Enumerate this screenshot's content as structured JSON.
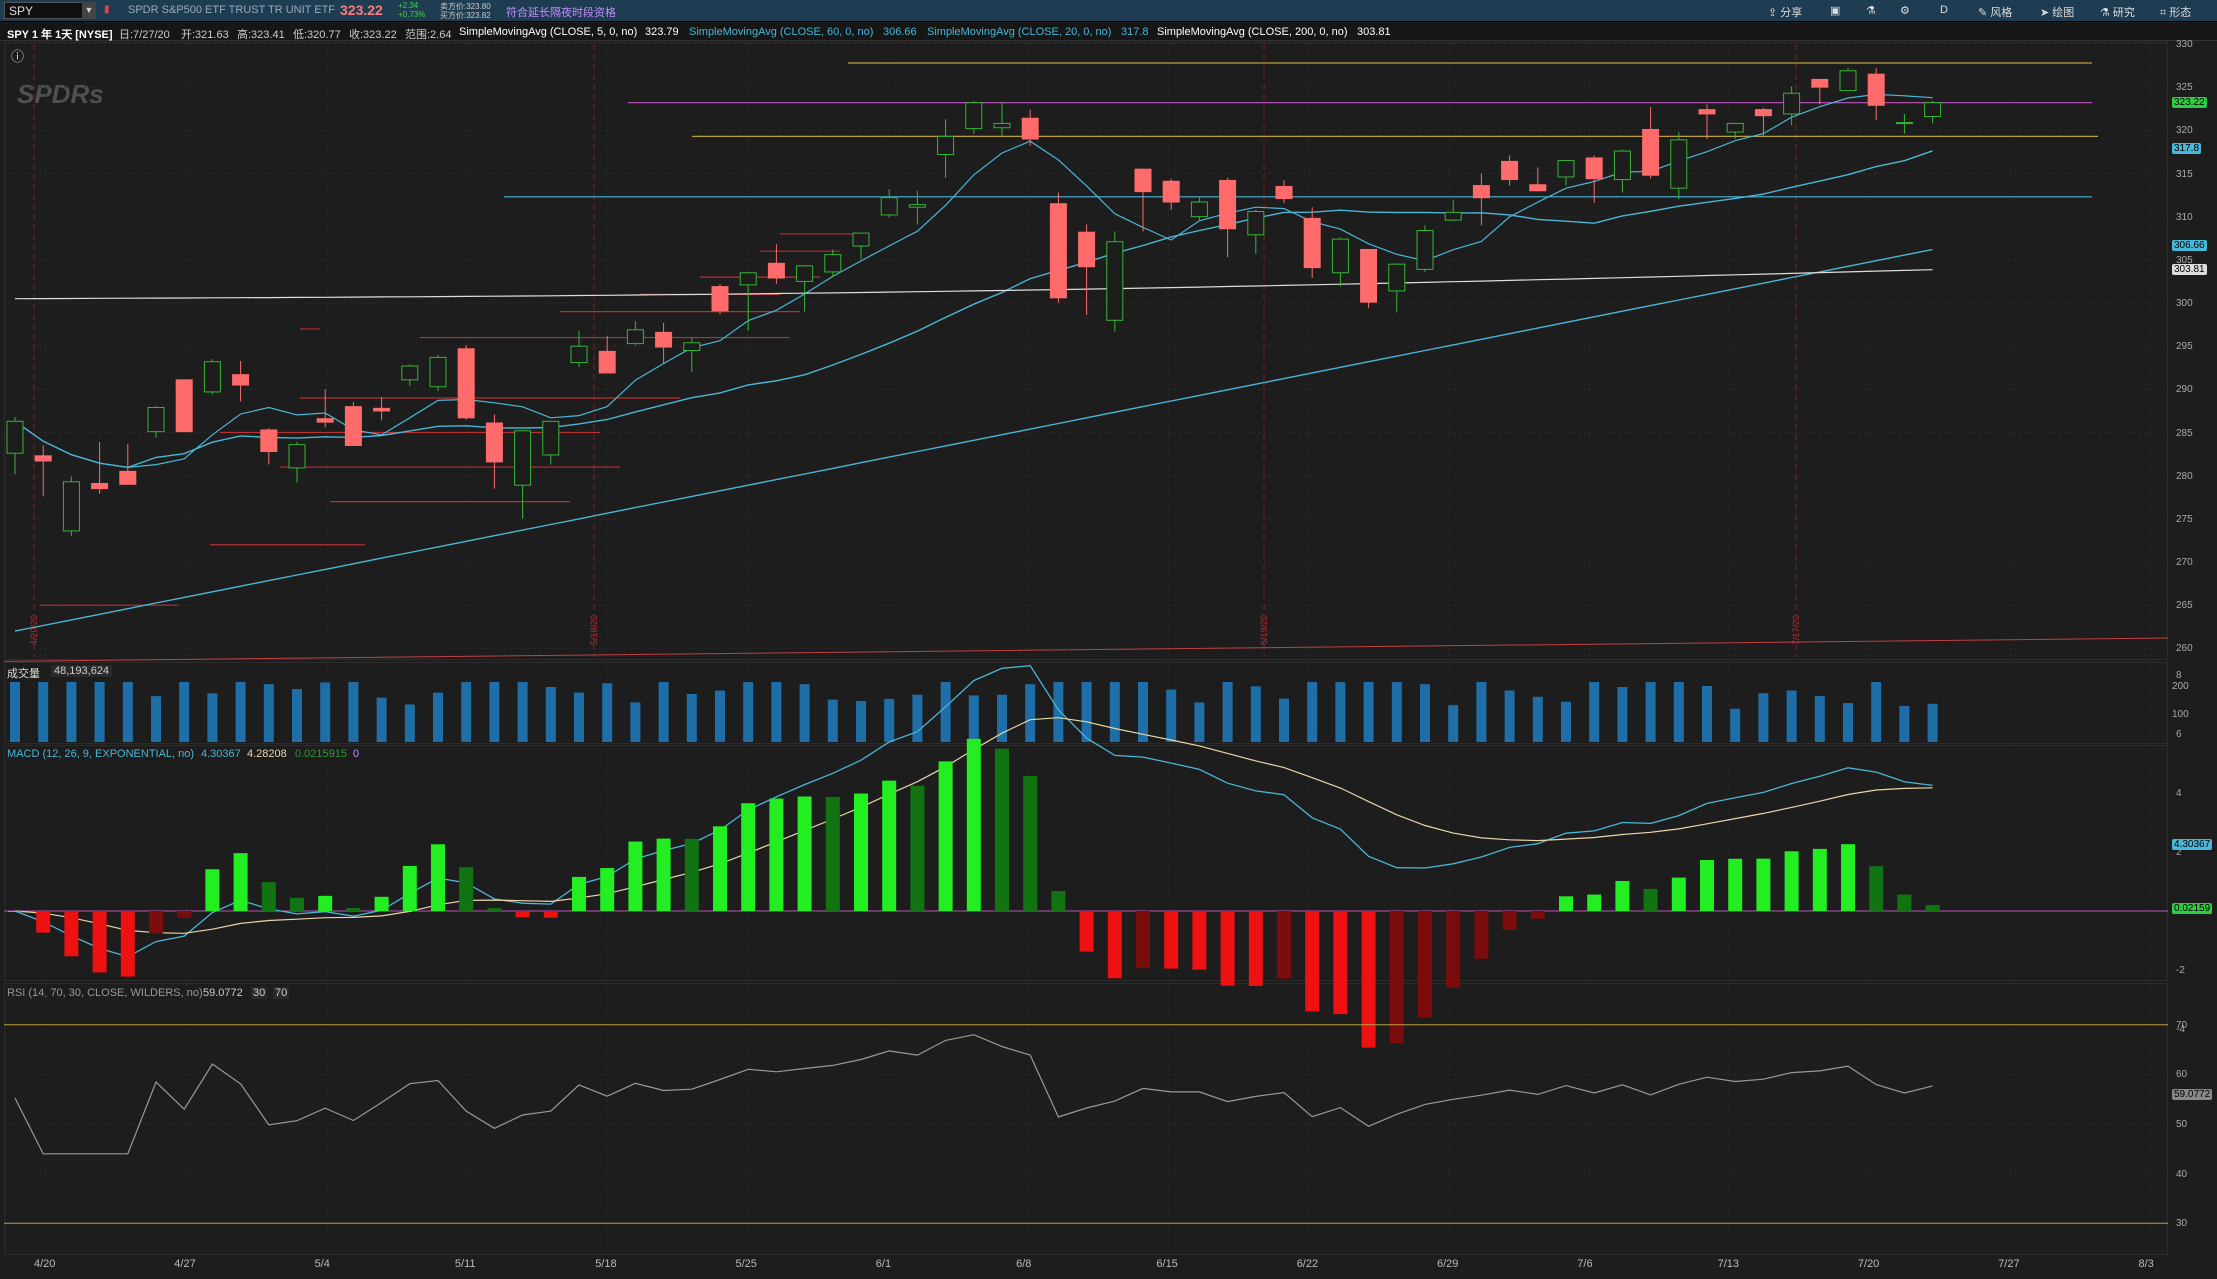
{
  "toolbar": {
    "symbol": "SPY",
    "description": "SPDR S&P500 ETF TRUST TR UNIT ETF",
    "last": "323.22",
    "change": "+2.34",
    "change_pct": "+0.73%",
    "bid": "卖方价:323.80",
    "ask": "买方价:323.82",
    "ext_hours": "符合延长隔夜时段资格",
    "share": "分享",
    "style": "风格",
    "draw": "绘图",
    "study": "研究",
    "pattern": "形态",
    "period": "D"
  },
  "info": {
    "title": "SPY 1 年 1天 [NYSE]",
    "date": "日:7/27/20",
    "open": "开:321.63",
    "high": "高:323.41",
    "low": "低:320.77",
    "close": "收:323.22",
    "range": "范围:2.64",
    "sma5_name": "SimpleMovingAvg (CLOSE, 5, 0, no)",
    "sma5_val": "323.79",
    "sma60_name": "SimpleMovingAvg (CLOSE, 60, 0, no)",
    "sma60_val": "306.66",
    "sma20_name": "SimpleMovingAvg (CLOSE, 20, 0, no)",
    "sma20_val": "317.8",
    "sma200_name": "SimpleMovingAvg (CLOSE, 200, 0, no)",
    "sma200_val": "303.81"
  },
  "watermark": "SPDRs",
  "price_axis": [
    "330",
    "325",
    "320",
    "315",
    "310",
    "305",
    "300",
    "295",
    "290",
    "285",
    "280",
    "275",
    "270",
    "265",
    "260"
  ],
  "price_tags": [
    {
      "text": "323.22",
      "color": "#2ecc40"
    },
    {
      "text": "317.8",
      "color": "#4ab6d8"
    },
    {
      "text": "306.66",
      "color": "#4ab6d8"
    },
    {
      "text": "303.81",
      "color": "#dddddd"
    }
  ],
  "volume": {
    "label": "成交量",
    "value": "48,193,624",
    "axis": [
      "200",
      "100"
    ]
  },
  "macd": {
    "label": "MACD (12, 26, 9, EXPONENTIAL, no)",
    "value": "4.30367",
    "avg": "4.28208",
    "diff": "0.0215915",
    "zero": "0",
    "axis": [
      "8",
      "6",
      "4",
      "2",
      "-2",
      "-4"
    ],
    "tag_value": "4.30367",
    "tag_diff": "0.02159"
  },
  "rsi": {
    "label": "RSI (14, 70, 30, CLOSE, WILDERS, no)",
    "value": "59.0772",
    "ob": "30",
    "os": "70",
    "axis": [
      "70",
      "60",
      "50",
      "40",
      "30"
    ],
    "tag": "59.0772"
  },
  "date_axis": [
    "4/20",
    "4/27",
    "5/4",
    "5/11",
    "5/18",
    "5/25",
    "6/1",
    "6/8",
    "6/15",
    "6/22",
    "6/29",
    "7/6",
    "7/13",
    "7/20",
    "7/27",
    "8/3"
  ],
  "vline_dates": [
    "4/20/20",
    "5/18/20",
    "6/19/20",
    "7/17/20"
  ],
  "chart_data": {
    "type": "candlestick",
    "x": [
      "4/20",
      "4/21",
      "4/22",
      "4/23",
      "4/24",
      "4/27",
      "4/28",
      "4/29",
      "4/30",
      "5/1",
      "5/4",
      "5/5",
      "5/6",
      "5/7",
      "5/8",
      "5/11",
      "5/12",
      "5/13",
      "5/14",
      "5/15",
      "5/18",
      "5/19",
      "5/20",
      "5/21",
      "5/22",
      "5/26",
      "5/27",
      "5/28",
      "5/29",
      "6/1",
      "6/2",
      "6/3",
      "6/4",
      "6/5",
      "6/8",
      "6/9",
      "6/10",
      "6/11",
      "6/12",
      "6/15",
      "6/16",
      "6/17",
      "6/18",
      "6/19",
      "6/22",
      "6/23",
      "6/24",
      "6/25",
      "6/26",
      "6/29",
      "6/30",
      "7/1",
      "7/2",
      "7/6",
      "7/7",
      "7/8",
      "7/9",
      "7/10",
      "7/13",
      "7/14",
      "7/15",
      "7/16",
      "7/17",
      "7/20",
      "7/21",
      "7/22",
      "7/23",
      "7/24",
      "7/27"
    ],
    "ohlc": [
      [
        282.6,
        286.8,
        280.2,
        286.3
      ],
      [
        282.3,
        283.5,
        277.6,
        281.7
      ],
      [
        273.6,
        279.9,
        273.0,
        279.3
      ],
      [
        279.1,
        283.9,
        277.9,
        278.5
      ],
      [
        280.5,
        283.7,
        279.0,
        279.0
      ],
      [
        285.1,
        288.1,
        284.4,
        287.9
      ],
      [
        291.1,
        291.1,
        285.5,
        285.1
      ],
      [
        289.7,
        293.5,
        289.4,
        293.2
      ],
      [
        291.7,
        293.3,
        288.6,
        290.5
      ],
      [
        285.3,
        285.5,
        281.3,
        282.8
      ],
      [
        280.9,
        283.9,
        279.2,
        283.6
      ],
      [
        286.6,
        290.0,
        285.6,
        286.2
      ],
      [
        288.0,
        288.5,
        283.8,
        283.5
      ],
      [
        287.8,
        289.1,
        286.4,
        287.5
      ],
      [
        291.1,
        292.9,
        290.4,
        292.7
      ],
      [
        290.3,
        294.0,
        289.8,
        293.7
      ],
      [
        294.7,
        295.1,
        286.5,
        286.7
      ],
      [
        286.1,
        287.1,
        278.5,
        281.6
      ],
      [
        278.9,
        285.3,
        275.0,
        285.2
      ],
      [
        282.4,
        286.3,
        281.3,
        286.3
      ],
      [
        293.1,
        296.8,
        292.6,
        295.0
      ],
      [
        294.4,
        296.2,
        291.9,
        291.9
      ],
      [
        295.3,
        297.9,
        295.1,
        296.9
      ],
      [
        296.6,
        297.7,
        293.0,
        294.9
      ],
      [
        294.5,
        296.0,
        292.0,
        295.4
      ],
      [
        301.9,
        302.2,
        298.7,
        299.1
      ],
      [
        302.1,
        303.6,
        296.8,
        303.5
      ],
      [
        304.6,
        306.8,
        302.2,
        302.9
      ],
      [
        302.5,
        304.4,
        299.0,
        304.3
      ],
      [
        303.6,
        306.2,
        303.0,
        305.6
      ],
      [
        306.6,
        308.1,
        305.1,
        308.1
      ],
      [
        310.2,
        313.2,
        309.9,
        312.2
      ],
      [
        311.1,
        313.0,
        309.1,
        311.4
      ],
      [
        317.2,
        321.3,
        314.5,
        319.3
      ],
      [
        320.2,
        323.4,
        319.6,
        323.2
      ],
      [
        320.3,
        323.3,
        319.4,
        320.8
      ],
      [
        321.4,
        322.4,
        318.2,
        319.0
      ],
      [
        311.5,
        312.8,
        300.0,
        300.6
      ],
      [
        308.2,
        309.1,
        298.6,
        304.2
      ],
      [
        298.0,
        308.3,
        296.7,
        307.1
      ],
      [
        315.5,
        315.6,
        308.3,
        312.9
      ],
      [
        314.1,
        314.4,
        310.8,
        311.7
      ],
      [
        310.0,
        312.3,
        309.5,
        311.7
      ],
      [
        314.2,
        314.5,
        305.3,
        308.6
      ],
      [
        307.9,
        310.8,
        305.7,
        310.6
      ],
      [
        313.5,
        314.2,
        311.6,
        312.1
      ],
      [
        309.8,
        311.1,
        302.9,
        304.1
      ],
      [
        303.5,
        307.6,
        301.9,
        307.4
      ],
      [
        306.2,
        306.2,
        299.4,
        300.1
      ],
      [
        301.4,
        304.6,
        298.9,
        304.5
      ],
      [
        303.9,
        309.0,
        303.6,
        308.4
      ],
      [
        309.6,
        311.9,
        309.5,
        310.5
      ],
      [
        313.6,
        315.0,
        309.0,
        312.2
      ],
      [
        316.4,
        317.1,
        313.6,
        314.3
      ],
      [
        313.7,
        315.7,
        312.9,
        313.0
      ],
      [
        314.6,
        316.5,
        313.6,
        316.5
      ],
      [
        316.8,
        317.1,
        311.6,
        314.4
      ],
      [
        314.3,
        317.8,
        312.8,
        317.6
      ],
      [
        320.1,
        322.7,
        314.4,
        314.8
      ],
      [
        313.3,
        319.8,
        312.0,
        318.9
      ],
      [
        322.4,
        323.0,
        319.0,
        321.9
      ],
      [
        319.8,
        320.9,
        319.0,
        320.8
      ],
      [
        322.4,
        322.6,
        319.4,
        321.7
      ],
      [
        321.9,
        325.1,
        320.6,
        324.3
      ],
      [
        325.9,
        325.9,
        323.0,
        325.0
      ],
      [
        324.6,
        327.2,
        324.5,
        326.9
      ],
      [
        326.5,
        327.2,
        321.2,
        322.9
      ],
      [
        320.9,
        321.9,
        319.6,
        320.9
      ],
      [
        321.6,
        323.4,
        320.8,
        323.2
      ]
    ],
    "volume_axis": [
      0,
      200
    ],
    "macd_axis": [
      -4,
      8
    ],
    "rsi_axis": [
      30,
      70
    ],
    "ylim": [
      259,
      330
    ]
  }
}
